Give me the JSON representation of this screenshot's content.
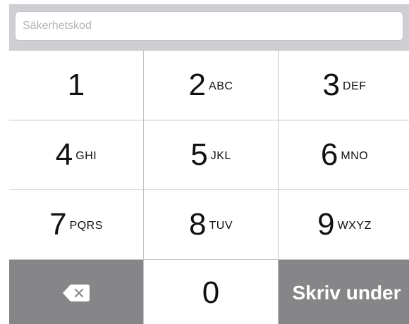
{
  "security_code_field": {
    "placeholder": "Säkerhetskod",
    "value": ""
  },
  "keypad": {
    "keys": [
      {
        "digit": "1",
        "letters": ""
      },
      {
        "digit": "2",
        "letters": "ABC"
      },
      {
        "digit": "3",
        "letters": "DEF"
      },
      {
        "digit": "4",
        "letters": "GHI"
      },
      {
        "digit": "5",
        "letters": "JKL"
      },
      {
        "digit": "6",
        "letters": "MNO"
      },
      {
        "digit": "7",
        "letters": "PQRS"
      },
      {
        "digit": "8",
        "letters": "TUV"
      },
      {
        "digit": "9",
        "letters": "WXYZ"
      },
      {
        "digit": "0",
        "letters": ""
      }
    ],
    "delete_icon": "backspace-icon",
    "submit_label": "Skriv under"
  },
  "colors": {
    "key_background": "#ffffff",
    "dark_key_background": "#868688",
    "keyboard_background": "#cfcfd3",
    "separator": "#c4c4c8",
    "text": "#111111"
  }
}
